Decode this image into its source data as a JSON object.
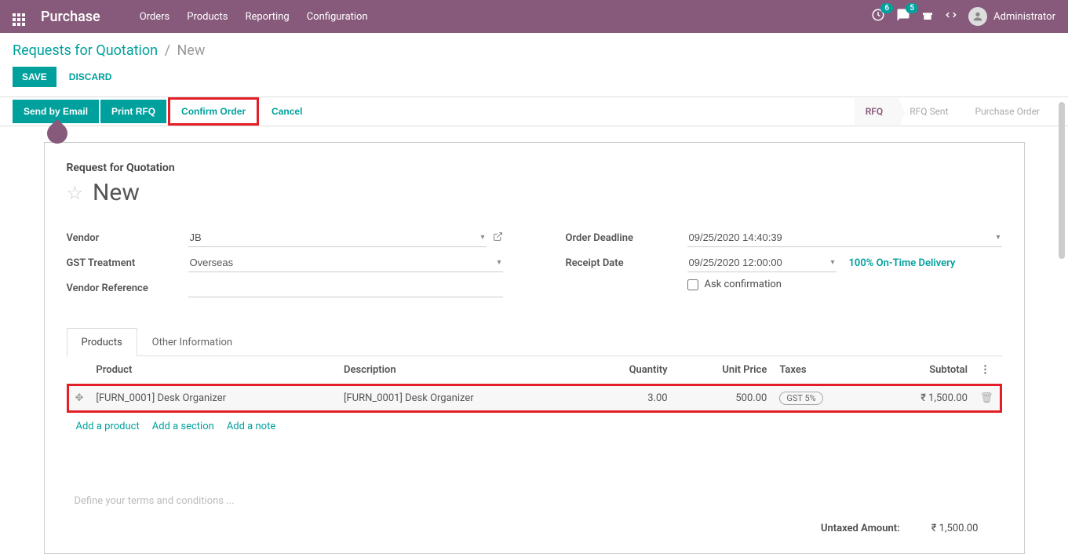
{
  "topbar": {
    "app_name": "Purchase",
    "menu": [
      "Orders",
      "Products",
      "Reporting",
      "Configuration"
    ],
    "badge1": "6",
    "badge2": "5",
    "user": "Administrator"
  },
  "breadcrumb": {
    "parent": "Requests for Quotation",
    "current": "New"
  },
  "buttons": {
    "save": "Save",
    "discard": "Discard",
    "send_email": "Send by Email",
    "print_rfq": "Print RFQ",
    "confirm": "Confirm Order",
    "cancel": "Cancel"
  },
  "stages": {
    "rfq": "RFQ",
    "sent": "RFQ Sent",
    "po": "Purchase Order"
  },
  "title": {
    "subtitle": "Request for Quotation",
    "name": "New"
  },
  "labels": {
    "vendor": "Vendor",
    "gst": "GST Treatment",
    "vendor_ref": "Vendor Reference",
    "deadline": "Order Deadline",
    "receipt": "Receipt Date",
    "ask_confirm": "Ask confirmation",
    "ontime": "100% On-Time Delivery"
  },
  "values": {
    "vendor": "JB",
    "gst": "Overseas",
    "vendor_ref": "",
    "deadline": "09/25/2020 14:40:39",
    "receipt": "09/25/2020 12:00:00"
  },
  "tabs": {
    "products": "Products",
    "other": "Other Information"
  },
  "table": {
    "headers": {
      "product": "Product",
      "description": "Description",
      "qty": "Quantity",
      "price": "Unit Price",
      "taxes": "Taxes",
      "subtotal": "Subtotal"
    },
    "row": {
      "product": "[FURN_0001] Desk Organizer",
      "description": "[FURN_0001] Desk Organizer",
      "qty": "3.00",
      "price": "500.00",
      "tax": "GST 5%",
      "subtotal": "₹ 1,500.00"
    },
    "add_product": "Add a product",
    "add_section": "Add a section",
    "add_note": "Add a note"
  },
  "terms": "Define your terms and conditions ...",
  "totals": {
    "untaxed_label": "Untaxed Amount:",
    "untaxed_value": "₹ 1,500.00"
  }
}
